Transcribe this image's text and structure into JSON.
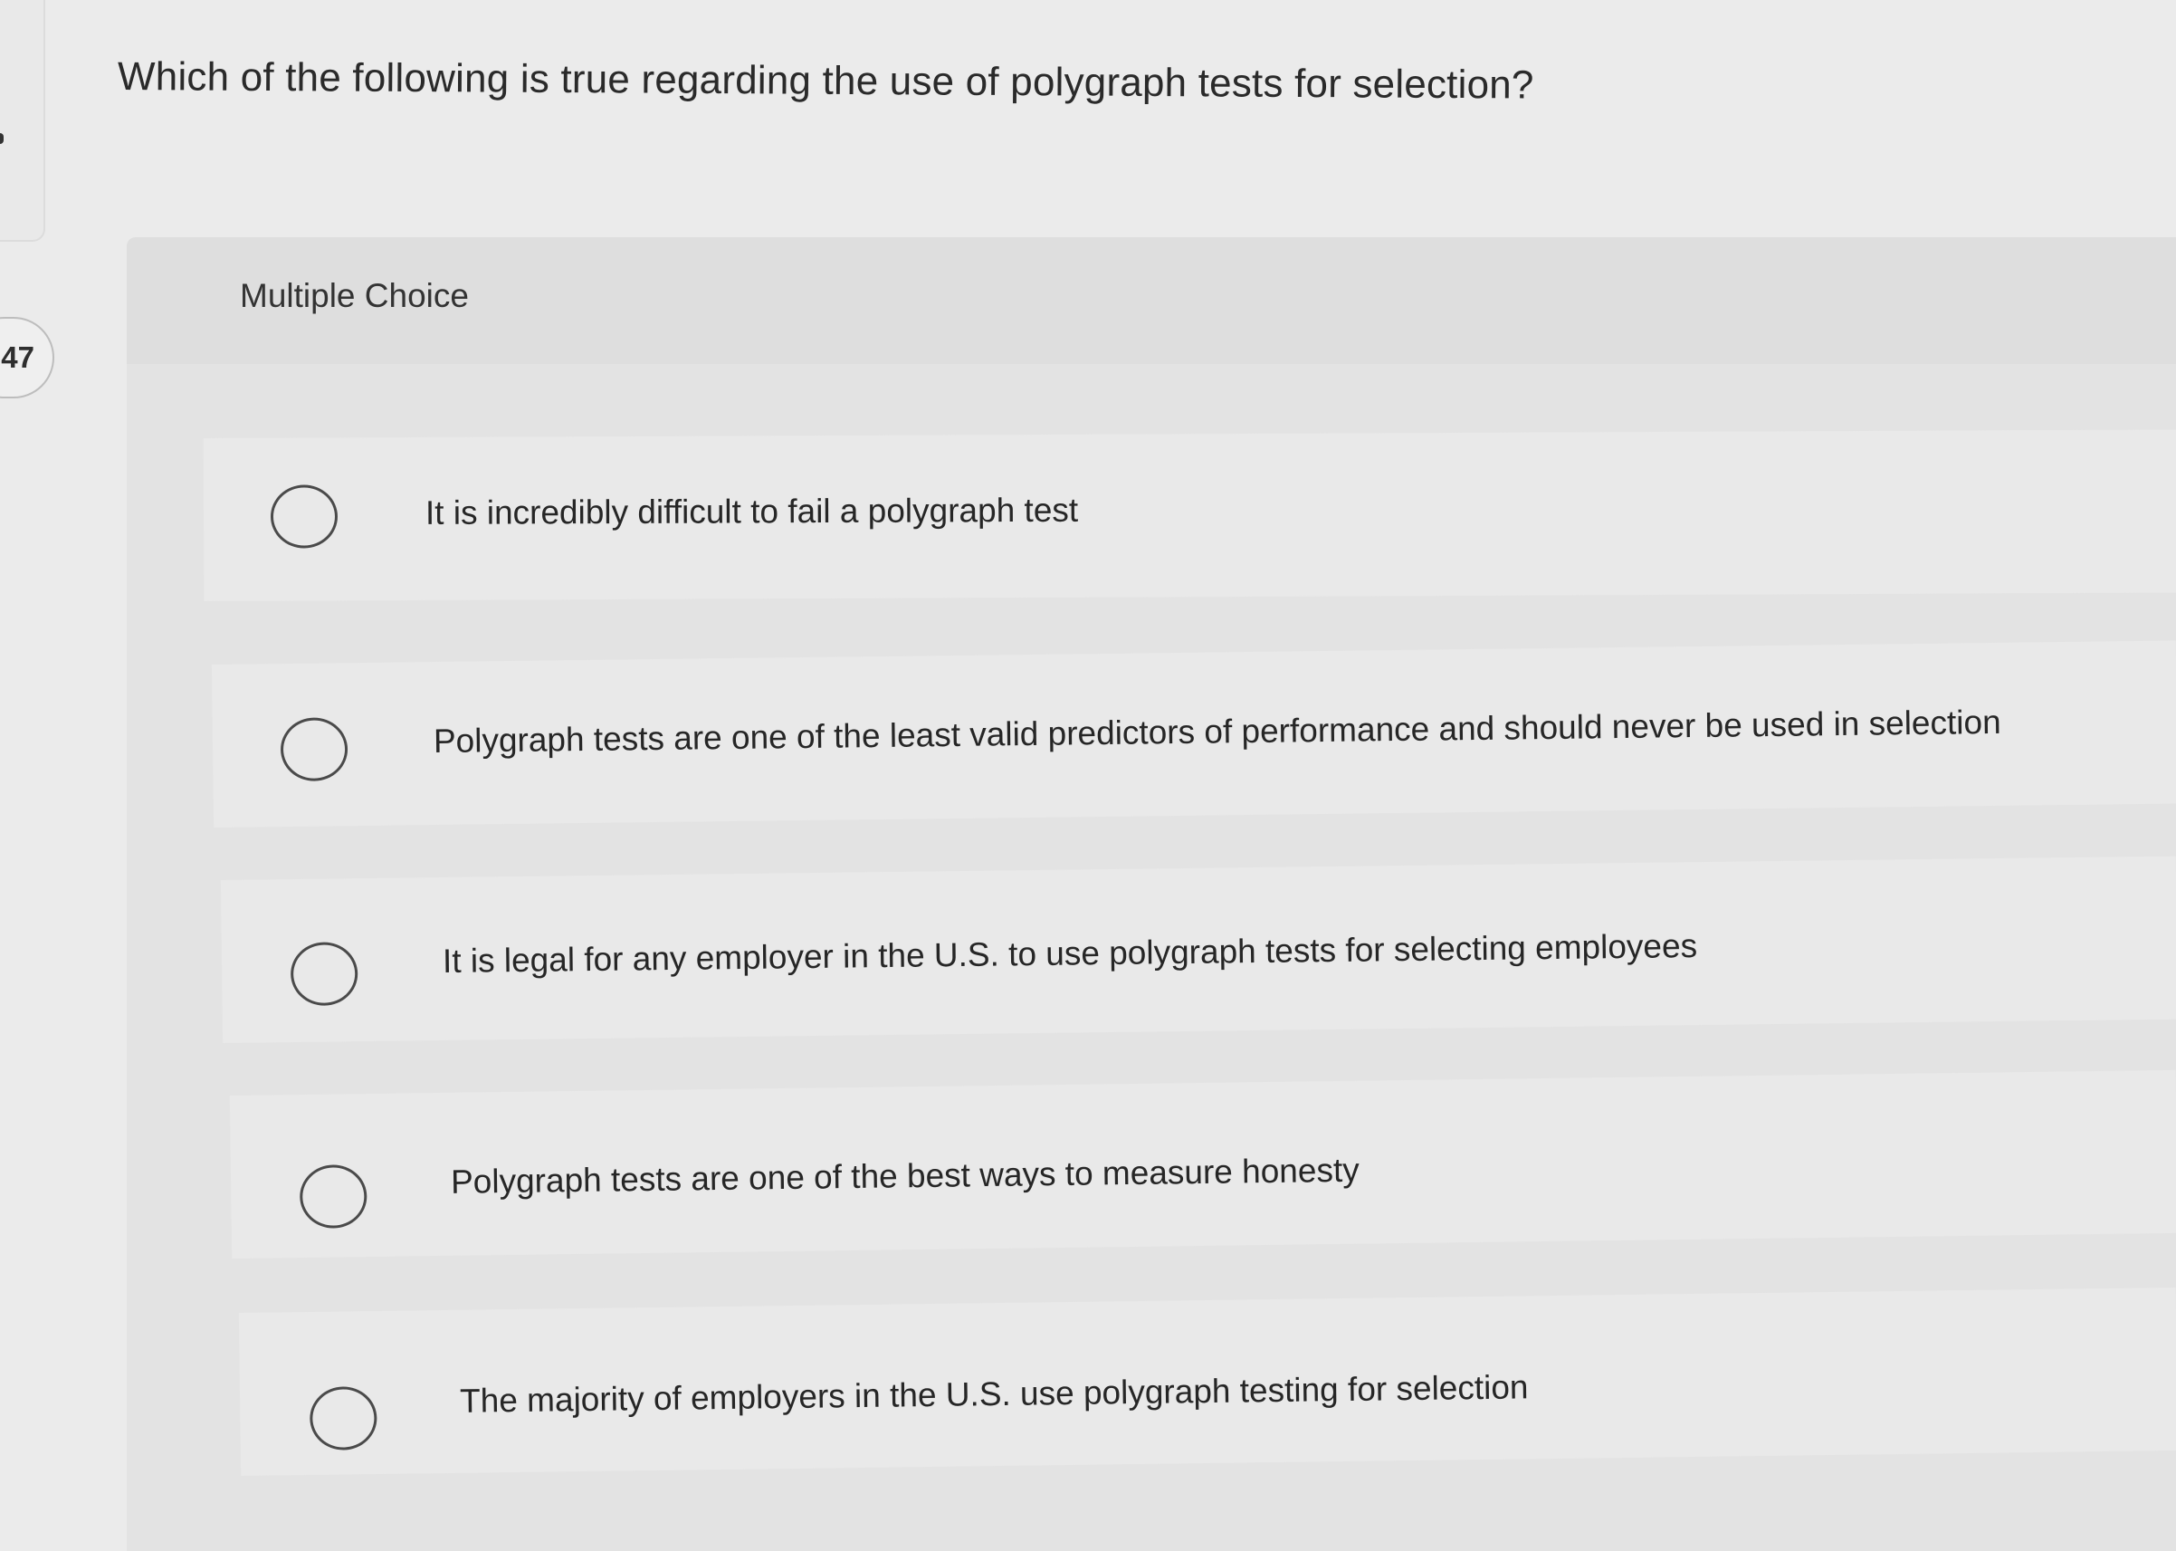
{
  "question": {
    "number_label": ":47",
    "text": "Which of the following is true regarding the use of polygraph tests for selection?",
    "type_label": "Multiple Choice"
  },
  "options": [
    {
      "label": "It is incredibly difficult to fail a polygraph test"
    },
    {
      "label": "Polygraph tests are one of the least valid predictors of performance and should never be used in selection"
    },
    {
      "label": "It is legal for any employer in the U.S. to use polygraph tests for selecting employees"
    },
    {
      "label": "Polygraph tests are one of the best ways to measure honesty"
    },
    {
      "label": "The majority of employers in the U.S. use polygraph testing for selection"
    }
  ]
}
